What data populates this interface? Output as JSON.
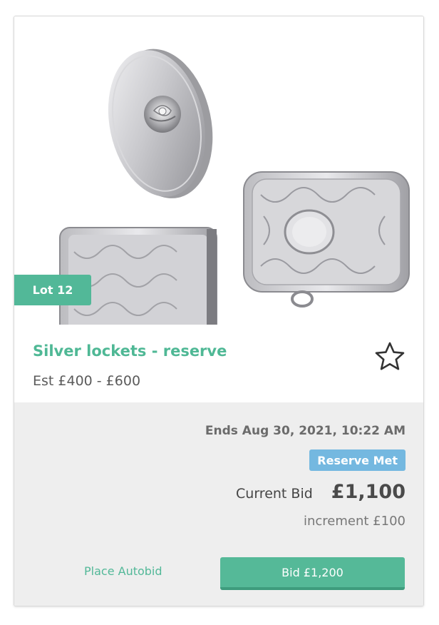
{
  "lot": {
    "badge": "Lot 12",
    "title": "Silver lockets - reserve",
    "estimate": "Est £400 - £600",
    "image_subject": "silver vesta cases and locket"
  },
  "auction": {
    "ends": "Ends Aug 30, 2021, 10:22 AM",
    "reserve_status": "Reserve Met",
    "current_bid_label": "Current Bid",
    "current_bid_amount": "£1,100",
    "increment": "increment £100"
  },
  "actions": {
    "autobid_label": "Place Autobid",
    "bid_label": "Bid £1,200"
  },
  "icons": {
    "favorite": "star-icon"
  },
  "colors": {
    "brand_green": "#52b898",
    "reserve_blue": "#74b8e0",
    "panel_gray": "#eeeeee"
  }
}
